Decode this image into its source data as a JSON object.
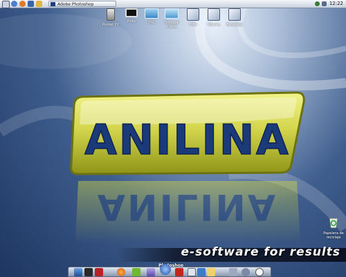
{
  "taskbar": {
    "window_title": "Adobe Photoshop",
    "clock": "12:22"
  },
  "desktop_icons": [
    {
      "label": "Pocket PC",
      "icon": "pocket-pc-icon"
    },
    {
      "label": "Pinky",
      "icon": "monitor-icon"
    },
    {
      "label": "VNC",
      "icon": "vnc-icon"
    },
    {
      "label": "Terminal Client",
      "icon": "terminal-client-icon"
    },
    {
      "label": "Cdfs",
      "icon": "drive-icon"
    },
    {
      "label": "Ubuntu",
      "icon": "drive-icon"
    },
    {
      "label": "Escaneos",
      "icon": "drive-icon"
    }
  ],
  "logo": {
    "text": "ANILINA"
  },
  "recycle_bin": {
    "label": "Papelera de reciclaje"
  },
  "tagline": "e-software for results",
  "dock": {
    "active_label": "Photoshop",
    "items": [
      "finder-icon",
      "terminal-icon",
      "book-icon",
      "firefox-icon",
      "pen-icon",
      "pyramid-icon",
      "photoshop-icon",
      "flash-icon",
      "folder-icon",
      "network-icon",
      "mail-icon",
      "tools-icon",
      "settings-icon",
      "clock-icon"
    ]
  },
  "colors": {
    "logo_green": "#c8cc3a",
    "logo_text": "#1b3a7a",
    "desktop_blue": "#3f5e8e"
  }
}
